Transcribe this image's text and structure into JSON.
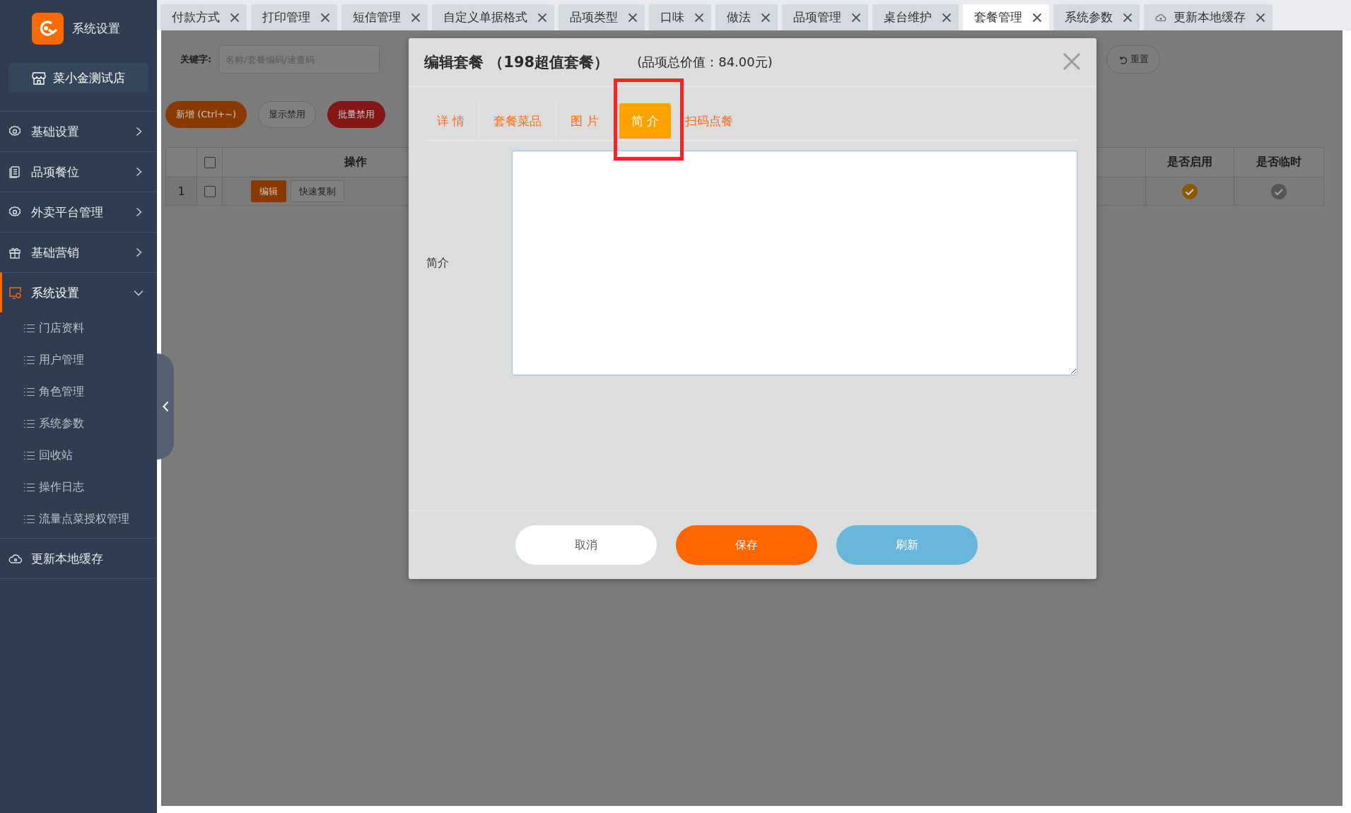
{
  "app": {
    "title": "系统设置",
    "store": "菜小金测试店"
  },
  "sidebar": {
    "items": [
      {
        "label": "基础设置",
        "kind": "group",
        "expanded": false,
        "selected": false
      },
      {
        "label": "品项餐位",
        "kind": "group",
        "expanded": false,
        "selected": false
      },
      {
        "label": "外卖平台管理",
        "kind": "group",
        "expanded": false,
        "selected": false
      },
      {
        "label": "基础营销",
        "kind": "group",
        "expanded": false,
        "selected": false
      },
      {
        "label": "系统设置",
        "kind": "group",
        "expanded": true,
        "selected": true,
        "children": [
          {
            "label": "门店资料"
          },
          {
            "label": "用户管理"
          },
          {
            "label": "角色管理"
          },
          {
            "label": "系统参数"
          },
          {
            "label": "回收站"
          },
          {
            "label": "操作日志"
          },
          {
            "label": "流量点菜授权管理"
          }
        ]
      },
      {
        "label": "更新本地缓存",
        "kind": "link",
        "expanded": false,
        "selected": false
      }
    ]
  },
  "tabs": [
    {
      "label": "付款方式",
      "kind": "plain",
      "selected": false
    },
    {
      "label": "打印管理",
      "kind": "plain",
      "selected": false
    },
    {
      "label": "短信管理",
      "kind": "plain",
      "selected": false
    },
    {
      "label": "自定义单据格式",
      "kind": "plain",
      "selected": false
    },
    {
      "label": "品项类型",
      "kind": "plain",
      "selected": false
    },
    {
      "label": "口味",
      "kind": "plain",
      "selected": false
    },
    {
      "label": "做法",
      "kind": "plain",
      "selected": false
    },
    {
      "label": "品项管理",
      "kind": "plain",
      "selected": false
    },
    {
      "label": "桌台维护",
      "kind": "plain",
      "selected": false
    },
    {
      "label": "套餐管理",
      "kind": "plain",
      "selected": true
    },
    {
      "label": "系统参数",
      "kind": "plain",
      "selected": false
    },
    {
      "label": "更新本地缓存",
      "kind": "cloud",
      "selected": false
    }
  ],
  "toolbar": {
    "keyword_label": "关键字:",
    "search": {
      "placeholder": "名称/套餐编码/速查码"
    },
    "reset_button": "重置",
    "buttons": [
      {
        "label": "新增 (Ctrl+~)",
        "kind": "primary"
      },
      {
        "label": "显示禁用",
        "kind": "default"
      },
      {
        "label": "批量禁用",
        "kind": "danger"
      }
    ]
  },
  "table": {
    "header_checked": false,
    "columns": [
      {
        "label": "操作"
      },
      {
        "label": "是否启用"
      },
      {
        "label": "是否临时"
      }
    ],
    "rows": [
      {
        "index": "1",
        "checked": false,
        "actions": [
          {
            "label": "编辑",
            "kind": "primary"
          },
          {
            "label": "快速复制",
            "kind": "default"
          }
        ],
        "enabled": true,
        "temporary": false
      }
    ]
  },
  "modal": {
    "title": "编辑套餐 （198超值套餐）",
    "subtitle": "(品项总价值：84.00元)",
    "tabs": [
      {
        "label": "详 情",
        "selected": false,
        "highlighted": false
      },
      {
        "label": "套餐菜品",
        "selected": false,
        "highlighted": false
      },
      {
        "label": "图 片",
        "selected": false,
        "highlighted": false
      },
      {
        "label": "简 介",
        "selected": true,
        "highlighted": true
      },
      {
        "label": "扫码点餐",
        "selected": false,
        "highlighted": false
      }
    ],
    "field": {
      "label": "简介"
    },
    "buttons": [
      {
        "label": "取消",
        "kind": "cancel"
      },
      {
        "label": "保存",
        "kind": "save"
      },
      {
        "label": "刷新",
        "kind": "refresh"
      }
    ]
  }
}
